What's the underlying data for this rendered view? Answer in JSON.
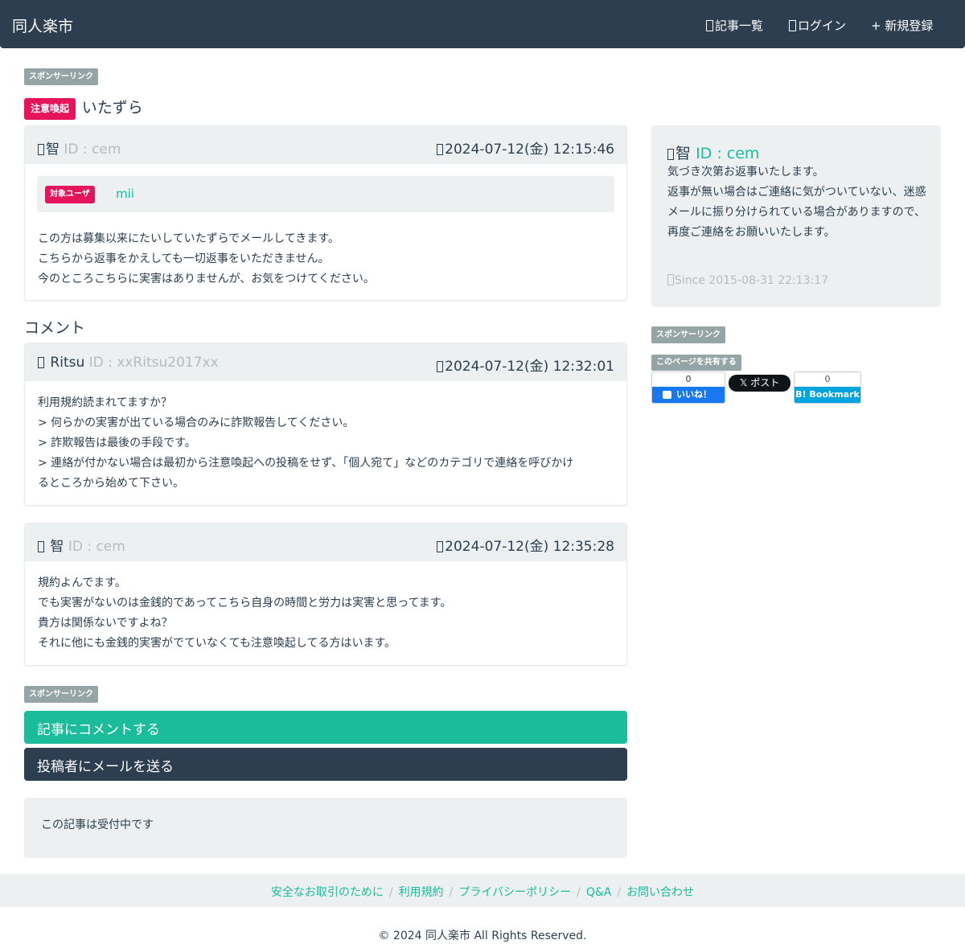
{
  "nav": {
    "brand": "同人楽市",
    "links": {
      "articles": "記事一覧",
      "login": "ログイン",
      "register": "+ 新規登録"
    }
  },
  "ads": {
    "top": "スポンサーリンク",
    "middle": "スポンサーリンク",
    "side": "スポンサーリンク"
  },
  "article": {
    "category": "注意喚起",
    "title": "いたずら",
    "author_name": "智",
    "author_id": "ID : cem",
    "date": "2024-07-12(金) 12:15:46",
    "target_label": "対象ユーザ",
    "target_user": "mii",
    "body": [
      "この方は募集以来にたいしていたずらでメールしてきます。",
      "こちらから返事をかえしても一切返事をいただきません。",
      "今のところこちらに実害はありませんが、お気をつけてください。"
    ]
  },
  "comments_title": "コメント",
  "comments": [
    {
      "name": "Ritsu",
      "id": "ID : xxRitsu2017xx",
      "date": "2024-07-12(金) 12:32:01",
      "body": [
        "利用規約読まれてますか？",
        "> 何らかの実害が出ている場合のみに詐欺報告してください。",
        "> 詐欺報告は最後の手段です。",
        "> 連絡が付かない場合は最初から注意喚起への投稿をせず、「個人宛て」などのカテゴリで連絡を呼びかけ",
        "るところから始めて下さい。"
      ]
    },
    {
      "name": "智",
      "id": "ID : cem",
      "date": "2024-07-12(金) 12:35:28",
      "body": [
        "規約よんでます。",
        "でも実害がないのは金銭的であってこちら自身の時間と労力は実害と思ってます。",
        "貴方は関係ないですよね？",
        "それに他にも金銭的実害がでていなくても注意喚起してる方はいます。"
      ]
    }
  ],
  "buttons": {
    "comment": "記事にコメントする",
    "mail": "投稿者にメールを送る"
  },
  "status": "この記事は受付中です",
  "sidebar": {
    "name": "智",
    "id": "ID : cem",
    "text": [
      "気づき次第お返事いたします。",
      "返事が無い場合はご連絡に気がついていない、迷惑メールに振り分けられている場合がありますので、",
      "再度ご連絡をお願いいたします。"
    ],
    "since": "Since 2015-08-31 22:13:17"
  },
  "share": {
    "label": "このページを共有する",
    "facebook_count": "0",
    "facebook_label": "いいね！",
    "x_label": "ポスト",
    "hatena_count": "0",
    "hatena_label": "B! Bookmark"
  },
  "footer": {
    "links": [
      "安全なお取引のために",
      "利用規約",
      "プライバシーポリシー",
      "Q&A",
      "お問い合わせ"
    ],
    "copyright": "© 2024 同人楽市 All Rights Reserved."
  },
  "colors": {
    "navbar": "#2c3e50",
    "accent": "#18bc9c",
    "alert": "#e6145a",
    "panel": "#ecf0f1"
  }
}
